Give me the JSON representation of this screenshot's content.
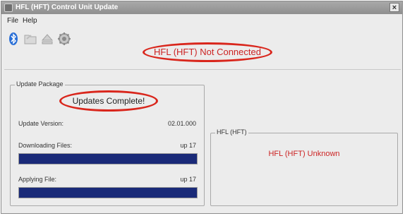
{
  "window": {
    "title": "HFL (HFT) Control Unit Update",
    "close_glyph": "×"
  },
  "menu": {
    "items": [
      "File",
      "Help"
    ]
  },
  "toolbar": {
    "icons": [
      "bluetooth-icon",
      "folder-icon",
      "eject-icon",
      "settings-icon"
    ]
  },
  "status": {
    "connection": "HFL (HFT) Not Connected"
  },
  "update_package": {
    "legend": "Update Package",
    "status": "Updates Complete!",
    "version_label": "Update Version:",
    "version_value": "02.01.000",
    "downloading_label": "Downloading Files:",
    "downloading_value": "up 17",
    "downloading_progress": 1.0,
    "applying_label": "Applying File:",
    "applying_value": "up 17",
    "applying_progress": 1.0
  },
  "hfl_panel": {
    "legend": "HFL (HFT)",
    "status": "HFL (HFT) Unknown"
  },
  "colors": {
    "accent_red": "#cc2424",
    "progress_fill": "#1a2a78",
    "annotation_red": "#d9261c"
  }
}
